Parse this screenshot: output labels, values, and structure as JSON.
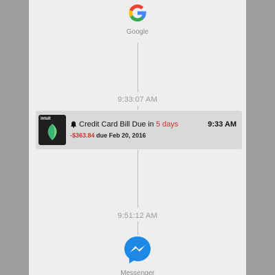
{
  "timeline": {
    "apps": [
      {
        "label": "Google",
        "icon": "google-g-icon"
      },
      {
        "label": "Messenger",
        "icon": "messenger-icon"
      }
    ],
    "timestamps": [
      "9:33:07 AM",
      "9:51:12 AM"
    ]
  },
  "notification": {
    "app_icon": "mint-intuit-icon",
    "brand": "intuit",
    "title_prefix": "Credit Card Bill Due in",
    "title_highlight": "5 days",
    "time": "9:33 AM",
    "amount": "-$363.84",
    "due_text": "due Feb 20, 2016",
    "highlight_color": "#d32f2f"
  },
  "colors": {
    "background": "#9e9e9e",
    "screen": "#eeeeee",
    "card": "#d9d9d9",
    "messenger_blue": "#1e88e5"
  }
}
